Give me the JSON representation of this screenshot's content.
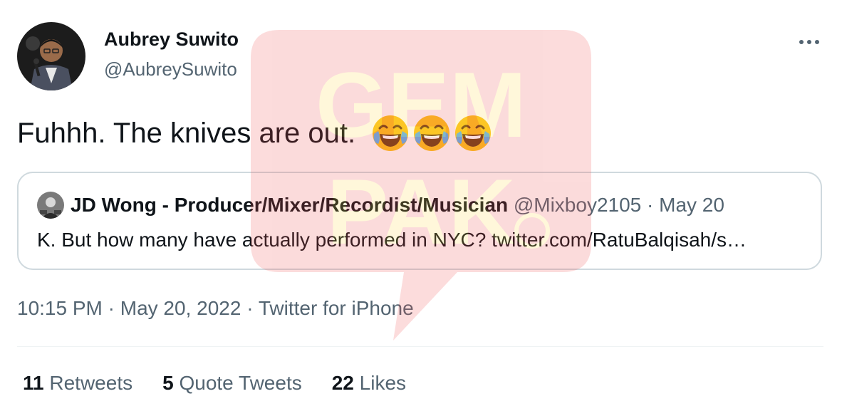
{
  "tweet": {
    "author": {
      "name": "Aubrey Suwito",
      "handle": "@AubreySuwito"
    },
    "text": "Fuhhh. The knives are out.",
    "emojis": [
      "😂",
      "😂",
      "😂"
    ],
    "emoji_name": "face-with-tears-of-joy",
    "quoted_tweet": {
      "author_name": "JD Wong - Producer/Mixer/Recordist/Musician",
      "handle": "@Mixboy2105",
      "date": "May 20",
      "separator": "·",
      "text": "K. But how many have actually performed in NYC? twitter.com/RatuBalqisah/s…"
    },
    "time": "10:15 PM",
    "date": "May 20, 2022",
    "source": "Twitter for iPhone",
    "separator": "·",
    "stats": {
      "retweets": {
        "count": "11",
        "label": "Retweets"
      },
      "quote_tweets": {
        "count": "5",
        "label": "Quote Tweets"
      },
      "likes": {
        "count": "22",
        "label": "Likes"
      }
    }
  },
  "watermark": {
    "text_line1": "GEM",
    "text_line2": "PAK",
    "color": "#f04e4e"
  },
  "colors": {
    "text_primary": "#0f1419",
    "text_secondary": "#536471",
    "border": "#cfd9de"
  }
}
